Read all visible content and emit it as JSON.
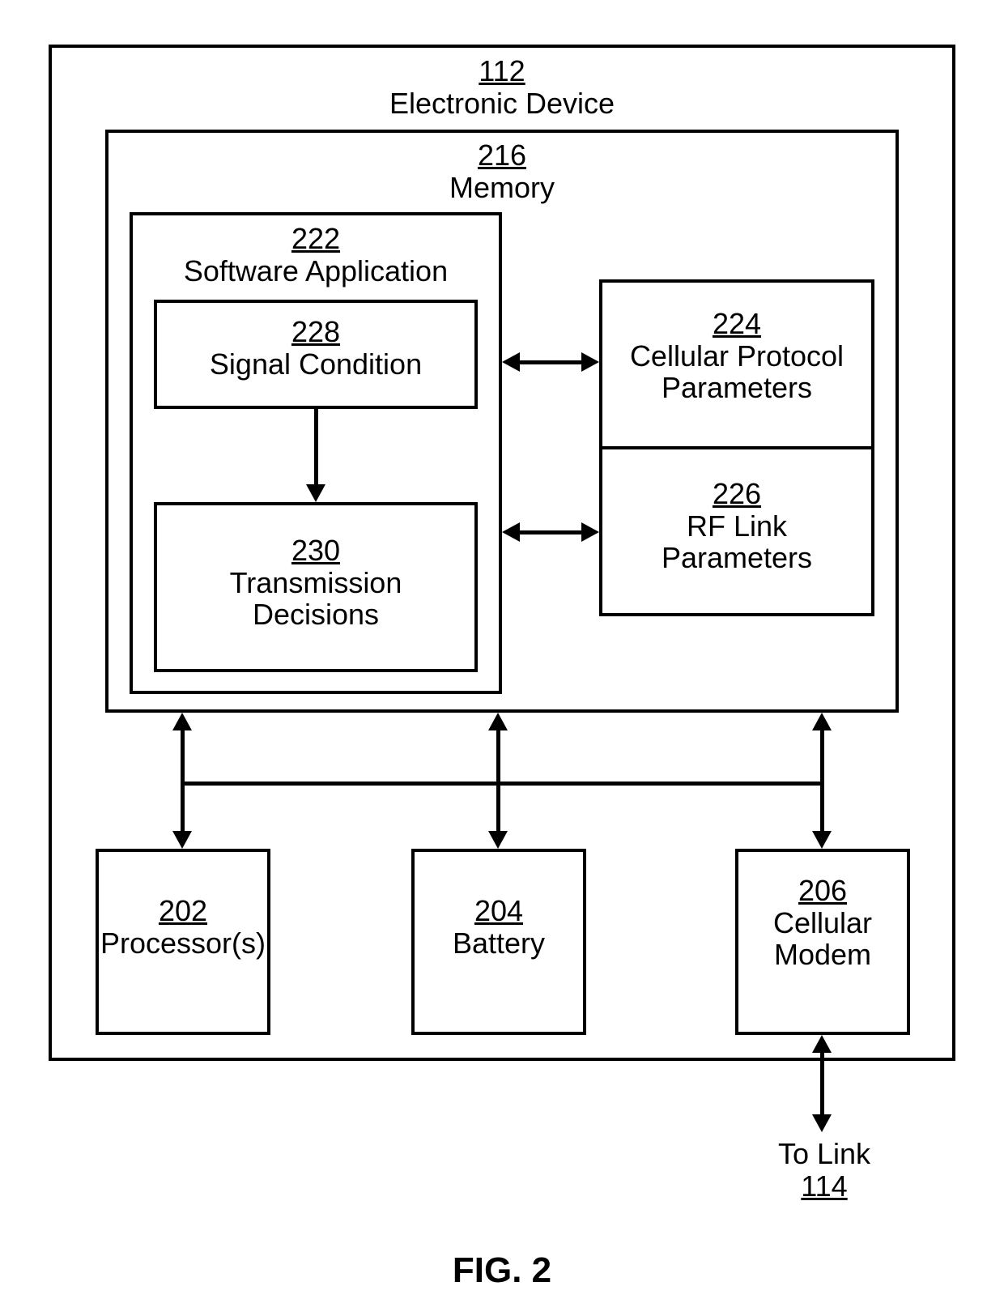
{
  "figure_label": "FIG. 2",
  "device": {
    "ref": "112",
    "name": "Electronic Device"
  },
  "memory": {
    "ref": "216",
    "name": "Memory"
  },
  "software": {
    "ref": "222",
    "name": "Software Application"
  },
  "signal": {
    "ref": "228",
    "name": "Signal Condition"
  },
  "trans": {
    "ref": "230",
    "name": "Transmission Decisions"
  },
  "cpp": {
    "ref": "224",
    "name": "Cellular Protocol Parameters"
  },
  "rf": {
    "ref": "226",
    "name": "RF Link Parameters"
  },
  "proc": {
    "ref": "202",
    "name": "Processor(s)"
  },
  "batt": {
    "ref": "204",
    "name": "Battery"
  },
  "modem": {
    "ref": "206",
    "name": "Cellular Modem"
  },
  "linkout": {
    "text": "To Link",
    "ref": "114"
  }
}
